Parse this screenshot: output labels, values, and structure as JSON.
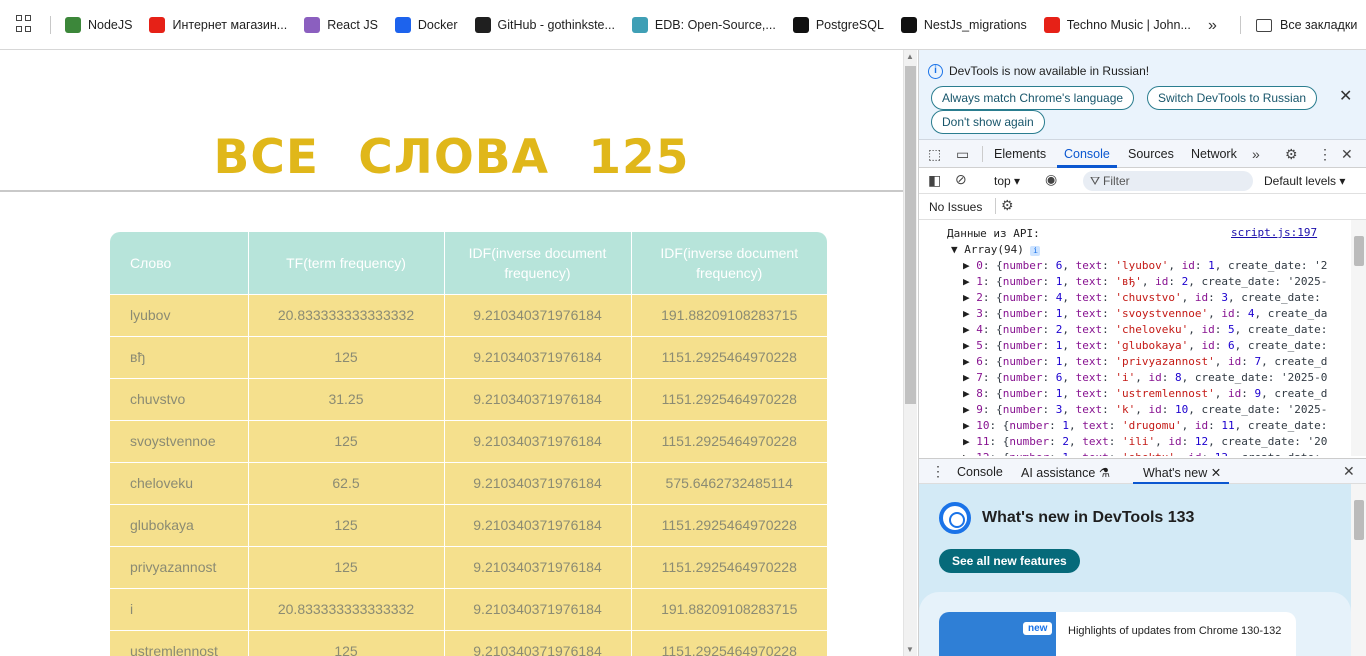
{
  "bookmarks": {
    "items": [
      {
        "label": "NodeJS",
        "icon": "nodejs-icon",
        "color": "#3c873a"
      },
      {
        "label": "Интернет магазин...",
        "icon": "youtube-icon",
        "color": "#e62117"
      },
      {
        "label": "React JS",
        "icon": "react-icon",
        "color": "#8b5fbf"
      },
      {
        "label": "Docker",
        "icon": "docker-icon",
        "color": "#1d63ed"
      },
      {
        "label": "GitHub - gothinkste...",
        "icon": "github-icon",
        "color": "#1f1f1f"
      },
      {
        "label": "EDB: Open-Source,...",
        "icon": "edb-icon",
        "color": "#3f9fb5"
      },
      {
        "label": "PostgreSQL",
        "icon": "postgresql-icon",
        "color": "#111111"
      },
      {
        "label": "NestJs_migrations",
        "icon": "nestjs-icon",
        "color": "#111111"
      },
      {
        "label": "Techno Music | John...",
        "icon": "youtube-icon",
        "color": "#e62117"
      }
    ],
    "more_label": "»",
    "all_label": "Все закладки"
  },
  "page": {
    "title": "ВСЕ СЛОВА 125",
    "title_color": "#e0b71a",
    "table": {
      "headers": [
        "Слово",
        "TF(term frequency)",
        "IDF(inverse document frequency)",
        "IDF(inverse document frequency)"
      ],
      "rows": [
        [
          "lyubov",
          "20.833333333333332",
          "9.210340371976184",
          "191.88209108283715"
        ],
        [
          "вђ",
          "125",
          "9.210340371976184",
          "1151.2925464970228"
        ],
        [
          "chuvstvo",
          "31.25",
          "9.210340371976184",
          "1151.2925464970228"
        ],
        [
          "svoystvennoe",
          "125",
          "9.210340371976184",
          "1151.2925464970228"
        ],
        [
          "cheloveku",
          "62.5",
          "9.210340371976184",
          "575.6462732485114"
        ],
        [
          "glubokaya",
          "125",
          "9.210340371976184",
          "1151.2925464970228"
        ],
        [
          "privyazannost",
          "125",
          "9.210340371976184",
          "1151.2925464970228"
        ],
        [
          "i",
          "20.833333333333332",
          "9.210340371976184",
          "191.88209108283715"
        ],
        [
          "ustremlennost",
          "125",
          "9.210340371976184",
          "1151.2925464970228"
        ]
      ]
    }
  },
  "devtools": {
    "info": {
      "text": "DevTools is now available in Russian!",
      "btn_match": "Always match Chrome's language",
      "btn_switch": "Switch DevTools to Russian",
      "btn_dont": "Don't show again"
    },
    "tabs": [
      "Elements",
      "Console",
      "Sources",
      "Network"
    ],
    "active_tab": "Console",
    "context": "top",
    "filter_placeholder": "Filter",
    "levels": "Default levels",
    "issues": "No Issues",
    "console": {
      "heading": "Данные из API:",
      "source": "script.js:197",
      "array_label": "Array(94)",
      "entries": [
        {
          "idx": "0",
          "number": "6",
          "text": "'lyubov'",
          "id": "1",
          "tail": "create_date: '2"
        },
        {
          "idx": "1",
          "number": "1",
          "text": "'вђ'",
          "id": "2",
          "tail": "create_date: '2025-"
        },
        {
          "idx": "2",
          "number": "4",
          "text": "'chuvstvo'",
          "id": "3",
          "tail": "create_date:"
        },
        {
          "idx": "3",
          "number": "1",
          "text": "'svoystvennoe'",
          "id": "4",
          "tail": "create_da"
        },
        {
          "idx": "4",
          "number": "2",
          "text": "'cheloveku'",
          "id": "5",
          "tail": "create_date:"
        },
        {
          "idx": "5",
          "number": "1",
          "text": "'glubokaya'",
          "id": "6",
          "tail": "create_date:"
        },
        {
          "idx": "6",
          "number": "1",
          "text": "'privyazannost'",
          "id": "7",
          "tail": "create_d"
        },
        {
          "idx": "7",
          "number": "6",
          "text": "'i'",
          "id": "8",
          "tail": "create_date: '2025-0"
        },
        {
          "idx": "8",
          "number": "1",
          "text": "'ustremlennost'",
          "id": "9",
          "tail": "create_d"
        },
        {
          "idx": "9",
          "number": "3",
          "text": "'k'",
          "id": "10",
          "tail": "create_date: '2025-"
        },
        {
          "idx": "10",
          "number": "1",
          "text": "'drugomu'",
          "id": "11",
          "tail": "create_date:"
        },
        {
          "idx": "11",
          "number": "2",
          "text": "'ili'",
          "id": "12",
          "tail": "create_date: '20"
        },
        {
          "idx": "12",
          "number": "1",
          "text": "'obektu'",
          "id": "13",
          "tail": "create_date:"
        }
      ]
    },
    "drawer": {
      "tabs": [
        "Console",
        "AI assistance",
        "What's new"
      ],
      "active": "What's new"
    },
    "whats_new": {
      "title": "What's new in DevTools 133",
      "button": "See all new features",
      "badge": "new",
      "card_text": "Highlights of updates from Chrome 130-132"
    }
  }
}
